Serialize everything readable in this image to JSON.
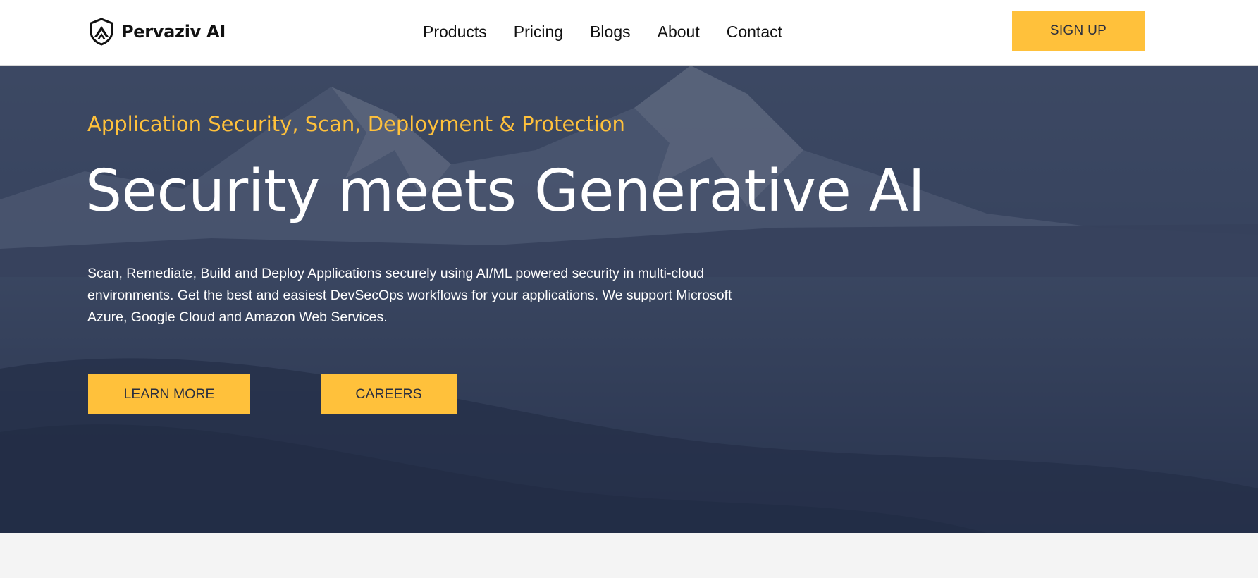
{
  "brand": {
    "name": "Pervaziv AI",
    "logo_icon": "shield-logo-icon"
  },
  "nav": {
    "items": [
      {
        "label": "Products"
      },
      {
        "label": "Pricing"
      },
      {
        "label": "Blogs"
      },
      {
        "label": "About"
      },
      {
        "label": "Contact"
      }
    ],
    "signup_label": "SIGN UP"
  },
  "hero": {
    "eyebrow": "Application Security, Scan, Deployment & Protection",
    "headline": "Security meets Generative AI",
    "description": "Scan, Remediate, Build and Deploy Applications securely using AI/ML powered security in multi-cloud environments. Get the best and easiest DevSecOps workflows for your applications. We support Microsoft Azure, Google Cloud and Amazon Web Services.",
    "buttons": {
      "learn_more": "LEARN MORE",
      "careers": "CAREERS"
    },
    "background": "snowy-mountain-lake-photo"
  },
  "colors": {
    "accent": "#ffc13b",
    "hero_overlay": "#2f3a55",
    "nav_bg": "#ffffff",
    "page_bg": "#f4f4f4"
  }
}
